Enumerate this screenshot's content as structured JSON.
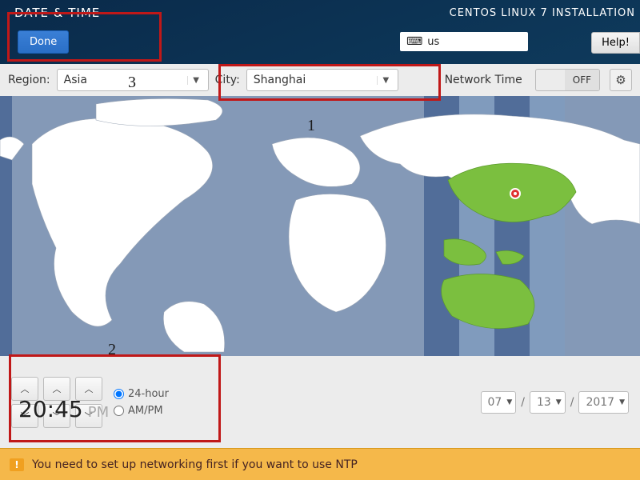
{
  "header": {
    "title": "DATE & TIME",
    "subtitle": "CENTOS LINUX 7 INSTALLATION",
    "done_label": "Done",
    "keyboard_layout": "us",
    "help_label": "Help!"
  },
  "toolbar": {
    "region_label": "Region:",
    "region_value": "Asia",
    "city_label": "City:",
    "city_value": "Shanghai",
    "network_time_label": "Network Time",
    "network_time_off": "OFF"
  },
  "time": {
    "hour": "20",
    "minute": "45",
    "ampm": "PM",
    "format_24": "24-hour",
    "format_ampm": "AM/PM"
  },
  "date": {
    "month": "07",
    "day": "13",
    "year": "2017",
    "separator": "/"
  },
  "warning": {
    "text": "You need to set up networking first if you want to use NTP"
  },
  "annotations": {
    "one": "1",
    "two": "2",
    "three": "3"
  }
}
